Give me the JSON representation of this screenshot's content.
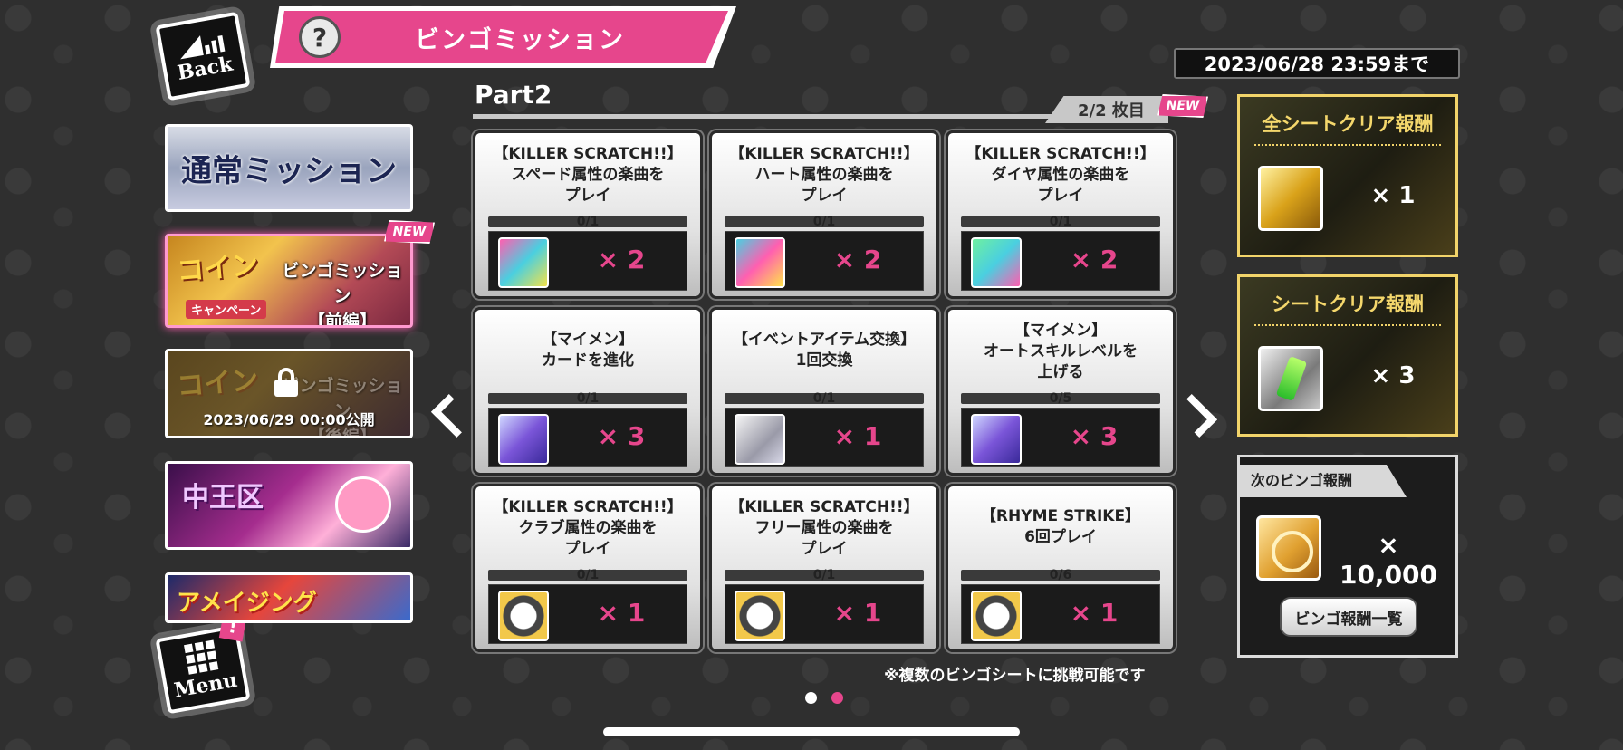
{
  "nav": {
    "back_label": "Back",
    "menu_label": "Menu",
    "menu_alert": "!"
  },
  "header": {
    "help_glyph": "?",
    "title": "ビンゴミッション",
    "deadline": "2023/06/28 23:59まで"
  },
  "sidebar": {
    "normal_mission": "通常ミッション",
    "new_tag": "NEW",
    "bingo_front": {
      "coin_text": "コイン",
      "campaign_text": "キャンペーン",
      "title_line1": "ビンゴミッション",
      "title_line2": "【前編】"
    },
    "bingo_back": {
      "coin_text": "コイン",
      "title_line1": "ビンゴミッション",
      "title_line2": "【後編】",
      "release": "2023/06/29 00:00公開"
    },
    "chuo_banner": "中王区",
    "amazing_banner": "アメイジング"
  },
  "board": {
    "part_label": "Part2",
    "page_indicator": "2/2 枚目",
    "new_tag": "NEW",
    "cells": [
      {
        "line1": "【KILLER SCRATCH!!】",
        "line2": "スペード属性の楽曲を",
        "line3": "プレイ",
        "progress": "0/1",
        "progress_fraction": 0,
        "item_icon": "spade-card-icon",
        "qty": "× 2"
      },
      {
        "line1": "【KILLER SCRATCH!!】",
        "line2": "ハート属性の楽曲を",
        "line3": "プレイ",
        "progress": "0/1",
        "progress_fraction": 0,
        "item_icon": "heart-card-icon",
        "qty": "× 2"
      },
      {
        "line1": "【KILLER SCRATCH!!】",
        "line2": "ダイヤ属性の楽曲を",
        "line3": "プレイ",
        "progress": "0/1",
        "progress_fraction": 0,
        "item_icon": "diamond-card-icon",
        "qty": "× 2"
      },
      {
        "line1": "【マイメン】",
        "line2": "カードを進化",
        "line3": "",
        "progress": "0/1",
        "progress_fraction": 0,
        "item_icon": "evolution-item-icon",
        "qty": "× 3"
      },
      {
        "line1": "【イベントアイテム交換】",
        "line2": "1回交換",
        "line3": "",
        "progress": "0/1",
        "progress_fraction": 0,
        "item_icon": "ticket-icon",
        "qty": "× 1"
      },
      {
        "line1": "【マイメン】",
        "line2": "オートスキルレベルを",
        "line3": "上げる",
        "progress": "0/5",
        "progress_fraction": 0,
        "item_icon": "evolution-item-icon",
        "qty": "× 3"
      },
      {
        "line1": "【KILLER SCRATCH!!】",
        "line2": "クラブ属性の楽曲を",
        "line3": "プレイ",
        "progress": "0/1",
        "progress_fraction": 0,
        "item_icon": "medal-icon",
        "qty": "× 1"
      },
      {
        "line1": "【KILLER SCRATCH!!】",
        "line2": "フリー属性の楽曲を",
        "line3": "プレイ",
        "progress": "0/1",
        "progress_fraction": 0,
        "item_icon": "medal-icon",
        "qty": "× 1"
      },
      {
        "line1": "【RHYME STRIKE】",
        "line2": "6回プレイ",
        "line3": "",
        "progress": "0/6",
        "progress_fraction": 0,
        "item_icon": "medal-icon",
        "qty": "× 1"
      }
    ],
    "footnote": "※複数のビンゴシートに挑戦可能です"
  },
  "rewards": {
    "all_clear": {
      "title": "全シートクリア報酬",
      "icon": "gold-ticket-icon",
      "qty": "× 1"
    },
    "sheet_clear": {
      "title": "シートクリア報酬",
      "icon": "battery-icon",
      "qty": "× 3"
    },
    "next_bingo": {
      "title": "次のビンゴ報酬",
      "icon": "coin-icon",
      "qty": "× 10,000",
      "list_button": "ビンゴ報酬一覧"
    }
  },
  "pagination": {
    "total": 2,
    "current": 2
  },
  "colors": {
    "accent": "#e6468c",
    "gold": "#f2d46a",
    "background": "#2f2f2f"
  }
}
